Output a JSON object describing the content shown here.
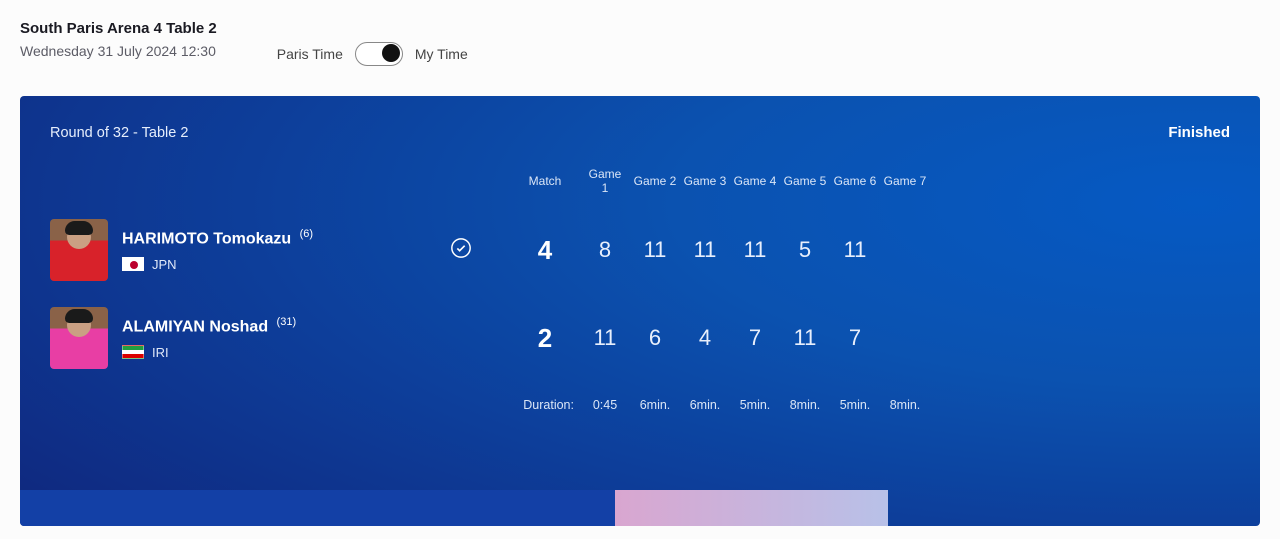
{
  "header": {
    "venue_title": "South Paris Arena 4 Table 2",
    "venue_date": "Wednesday 31 July 2024 12:30",
    "paris_time_label": "Paris Time",
    "my_time_label": "My Time"
  },
  "card": {
    "round_label": "Round of 32 - Table 2",
    "status_label": "Finished",
    "columns": {
      "match": "Match",
      "game1": "Game\n1",
      "game2": "Game 2",
      "game3": "Game 3",
      "game4": "Game 4",
      "game5": "Game 5",
      "game6": "Game 6",
      "game7": "Game 7"
    },
    "players": [
      {
        "name": "HARIMOTO Tomokazu",
        "seed": "(6)",
        "country_code": "JPN",
        "jersey_color": "#d8222a",
        "flag_class": "flag-jpn",
        "winner": true,
        "match_score": "4",
        "games": [
          "8",
          "11",
          "11",
          "11",
          "5",
          "11",
          ""
        ]
      },
      {
        "name": "ALAMIYAN Noshad",
        "seed": "(31)",
        "country_code": "IRI",
        "jersey_color": "#e83ea4",
        "flag_class": "flag-iri",
        "winner": false,
        "match_score": "2",
        "games": [
          "11",
          "6",
          "4",
          "7",
          "11",
          "7",
          ""
        ]
      }
    ],
    "duration": {
      "label": "Duration:",
      "total": "0:45",
      "games": [
        "6min.",
        "6min.",
        "5min.",
        "8min.",
        "5min.",
        "8min.",
        ""
      ]
    }
  }
}
